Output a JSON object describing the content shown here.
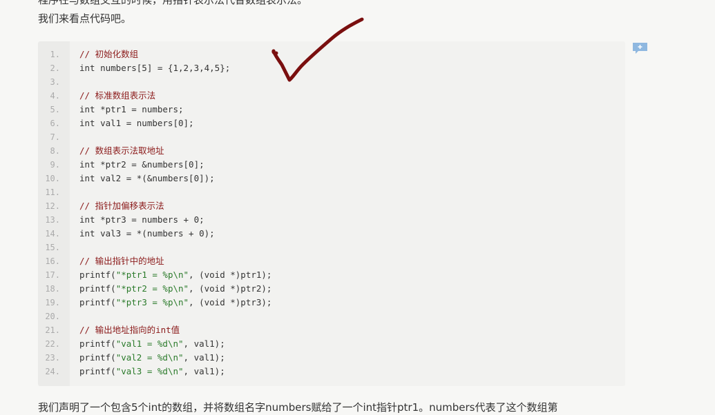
{
  "paragraphs": {
    "top1": "程序在与数组交互的时候，用指针表示法代替数组表示法。",
    "top2": "我们来看点代码吧。",
    "bottom": "我们声明了一个包含5个int的数组，并将数组名字numbers赋给了一个int指针ptr1。numbers代表了这个数组第"
  },
  "code": {
    "lines": [
      {
        "n": "1.",
        "text": "// 初始化数组",
        "kind": "comment"
      },
      {
        "n": "2.",
        "text": "int numbers[5] = {1,2,3,4,5};",
        "kind": "code"
      },
      {
        "n": "3.",
        "text": "",
        "kind": "code"
      },
      {
        "n": "4.",
        "text": "// 标准数组表示法",
        "kind": "comment"
      },
      {
        "n": "5.",
        "text": "int *ptr1 = numbers;",
        "kind": "code"
      },
      {
        "n": "6.",
        "text": "int val1 = numbers[0];",
        "kind": "code"
      },
      {
        "n": "7.",
        "text": "",
        "kind": "code"
      },
      {
        "n": "8.",
        "text": "// 数组表示法取地址",
        "kind": "comment"
      },
      {
        "n": "9.",
        "text": "int *ptr2 = &numbers[0];",
        "kind": "code"
      },
      {
        "n": "10.",
        "text": "int val2 = *(&numbers[0]);",
        "kind": "code"
      },
      {
        "n": "11.",
        "text": "",
        "kind": "code"
      },
      {
        "n": "12.",
        "text": "// 指针加偏移表示法",
        "kind": "comment"
      },
      {
        "n": "13.",
        "text": "int *ptr3 = numbers + 0;",
        "kind": "code"
      },
      {
        "n": "14.",
        "text": "int val3 = *(numbers + 0);",
        "kind": "code"
      },
      {
        "n": "15.",
        "text": "",
        "kind": "code"
      },
      {
        "n": "16.",
        "text": "// 输出指针中的地址",
        "kind": "comment"
      },
      {
        "n": "17.",
        "text": "printf(\"*ptr1 = %p\\n\", (void *)ptr1);",
        "kind": "code"
      },
      {
        "n": "18.",
        "text": "printf(\"*ptr2 = %p\\n\", (void *)ptr2);",
        "kind": "code"
      },
      {
        "n": "19.",
        "text": "printf(\"*ptr3 = %p\\n\", (void *)ptr3);",
        "kind": "code"
      },
      {
        "n": "20.",
        "text": "",
        "kind": "code"
      },
      {
        "n": "21.",
        "text": "// 输出地址指向的int值",
        "kind": "comment"
      },
      {
        "n": "22.",
        "text": "printf(\"val1 = %d\\n\", val1);",
        "kind": "code"
      },
      {
        "n": "23.",
        "text": "printf(\"val2 = %d\\n\", val1);",
        "kind": "code"
      },
      {
        "n": "24.",
        "text": "printf(\"val3 = %d\\n\", val1);",
        "kind": "code"
      }
    ]
  },
  "icons": {
    "comment_add": "add-comment-icon",
    "annotation": "checkmark-icon"
  },
  "colors": {
    "comment_text": "#8b1a1a",
    "string_text": "#2a7a2a",
    "checkmark": "#7a0f0f",
    "comment_icon": "#8fb8e0"
  }
}
